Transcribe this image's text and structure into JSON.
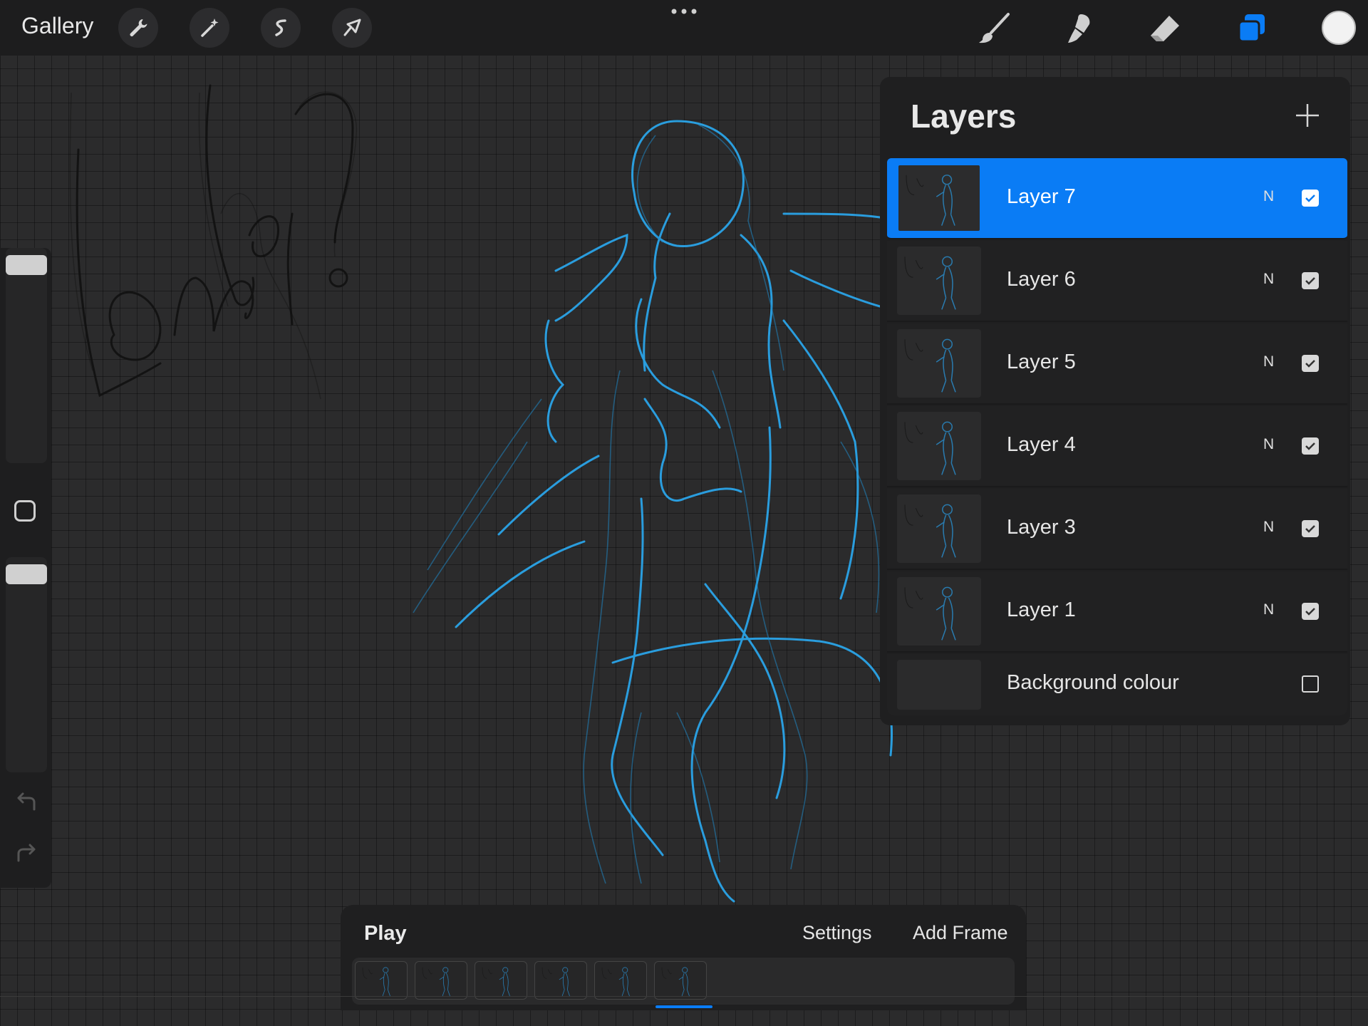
{
  "topbar": {
    "gallery_label": "Gallery",
    "left_tools": [
      "wrench-icon",
      "magic-wand-icon",
      "selection-icon",
      "transform-arrow-icon"
    ],
    "right_tools": [
      "brush-icon",
      "smudge-icon",
      "eraser-icon",
      "layers-icon"
    ],
    "active_color": "#f2f2f2",
    "accent_color": "#0a7cf5"
  },
  "canvas": {
    "sketch_text": "Lonely?",
    "stroke_color": "#2aa4e8"
  },
  "sidebar": {
    "items": [
      "brush-size-slider",
      "modify-button",
      "opacity-slider",
      "undo-icon",
      "redo-icon"
    ]
  },
  "layers_panel": {
    "title": "Layers",
    "add_icon": "plus-icon",
    "layers": [
      {
        "name": "Layer 7",
        "blend": "N",
        "visible": true,
        "active": true
      },
      {
        "name": "Layer 6",
        "blend": "N",
        "visible": true,
        "active": false
      },
      {
        "name": "Layer 5",
        "blend": "N",
        "visible": true,
        "active": false
      },
      {
        "name": "Layer 4",
        "blend": "N",
        "visible": true,
        "active": false
      },
      {
        "name": "Layer 3",
        "blend": "N",
        "visible": true,
        "active": false
      },
      {
        "name": "Layer 1",
        "blend": "N",
        "visible": true,
        "active": false
      }
    ],
    "background": {
      "name": "Background colour",
      "visible": false
    }
  },
  "animation": {
    "play_label": "Play",
    "settings_label": "Settings",
    "add_frame_label": "Add Frame",
    "frame_count": 6
  }
}
